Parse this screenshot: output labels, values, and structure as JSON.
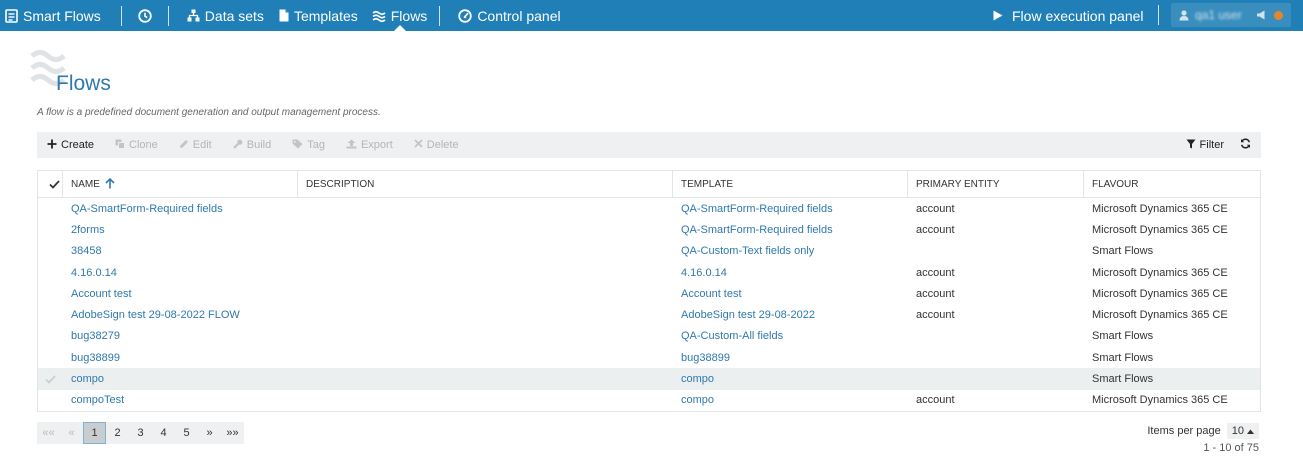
{
  "nav": {
    "brand": "Smart Flows",
    "items": [
      {
        "label": "Data sets"
      },
      {
        "label": "Templates"
      },
      {
        "label": "Flows"
      },
      {
        "label": "Control panel"
      }
    ],
    "execution_panel": "Flow execution panel",
    "user_name": "qa1 user",
    "bar_color": "#1f7fb6"
  },
  "page": {
    "title": "Flows",
    "description": "A flow is a predefined document generation and output management process."
  },
  "toolbar": {
    "create": "Create",
    "clone": "Clone",
    "edit": "Edit",
    "build": "Build",
    "tag": "Tag",
    "export": "Export",
    "delete": "Delete",
    "filter": "Filter"
  },
  "table": {
    "columns": {
      "name": "NAME",
      "description": "DESCRIPTION",
      "template": "TEMPLATE",
      "entity": "PRIMARY ENTITY",
      "flavour": "FLAVOUR"
    },
    "rows": [
      {
        "name": "QA-SmartForm-Required fields",
        "description": "",
        "template": "QA-SmartForm-Required fields",
        "entity": "account",
        "flavour": "Microsoft Dynamics 365 CE"
      },
      {
        "name": "2forms",
        "description": "",
        "template": "QA-SmartForm-Required fields",
        "entity": "account",
        "flavour": "Microsoft Dynamics 365 CE"
      },
      {
        "name": "38458",
        "description": "",
        "template": "QA-Custom-Text fields only",
        "entity": "",
        "flavour": "Smart Flows"
      },
      {
        "name": "4.16.0.14",
        "description": "",
        "template": "4.16.0.14",
        "entity": "account",
        "flavour": "Microsoft Dynamics 365 CE"
      },
      {
        "name": "Account test",
        "description": "",
        "template": "Account test",
        "entity": "account",
        "flavour": "Microsoft Dynamics 365 CE"
      },
      {
        "name": "AdobeSign test 29-08-2022 FLOW",
        "description": "",
        "template": "AdobeSign test 29-08-2022",
        "entity": "account",
        "flavour": "Microsoft Dynamics 365 CE"
      },
      {
        "name": "bug38279",
        "description": "",
        "template": "QA-Custom-All fields",
        "entity": "",
        "flavour": "Smart Flows"
      },
      {
        "name": "bug38899",
        "description": "",
        "template": "bug38899",
        "entity": "",
        "flavour": "Smart Flows"
      },
      {
        "name": "compo",
        "description": "",
        "template": "compo",
        "entity": "",
        "flavour": "Smart Flows",
        "selected": true
      },
      {
        "name": "compoTest",
        "description": "",
        "template": "compo",
        "entity": "account",
        "flavour": "Microsoft Dynamics 365 CE"
      }
    ]
  },
  "pager": {
    "first": "««",
    "prev": "«",
    "pages": [
      "1",
      "2",
      "3",
      "4",
      "5"
    ],
    "current": "1",
    "next": "»",
    "last": "»»",
    "items_per_page_label": "Items per page",
    "items_per_page": "10",
    "range": "1 - 10 of 75"
  }
}
